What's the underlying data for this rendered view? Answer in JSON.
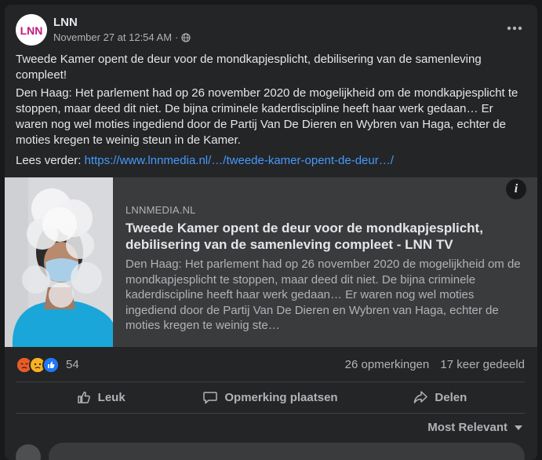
{
  "post": {
    "page_name": "LNN",
    "timestamp": "November 27 at 12:54 AM",
    "separator": "·",
    "privacy_icon": "globe-icon",
    "avatar_text": "LNN",
    "more_icon": "more-icon",
    "text_title": "Tweede Kamer opent de deur voor de mondkapjesplicht, debilisering van de samenleving compleet!",
    "text_body": "Den Haag: Het parlement had op 26 november 2020 de mogelijkheid om de mondkapjesplicht te stoppen, maar deed dit niet. De bijna criminele kaderdiscipline heeft haar werk gedaan… Er waren nog wel moties ingediend door de Partij Van De Dieren en Wybren van Haga, echter de moties kregen te weinig steun in de Kamer.",
    "read_more_label": "Lees verder:",
    "read_more_url": "https://www.lnnmedia.nl/…/tweede-kamer-opent-de-deur…/"
  },
  "preview": {
    "domain": "LNNMEDIA.NL",
    "title": "Tweede Kamer opent de deur voor de mondkapjesplicht, debilisering van de samenleving compleet - LNN TV",
    "description": "Den Haag: Het parlement had op 26 november 2020 de mogelijkheid om de mondkapjesplicht te stoppen, maar deed dit niet. De bijna criminele kaderdiscipline heeft haar werk gedaan… Er waren nog wel moties ingediend door de Partij Van De Dieren en Wybren van Haga, echter de moties kregen te weinig ste…",
    "info_label": "i"
  },
  "engagement": {
    "reaction_count": "54",
    "comments": "26 opmerkingen",
    "shares": "17 keer gedeeld",
    "reactions": [
      "angry",
      "sad",
      "like"
    ]
  },
  "actions": {
    "like": "Leuk",
    "comment": "Opmerking plaatsen",
    "share": "Delen"
  },
  "comments": {
    "sort_label": "Most Relevant"
  },
  "colors": {
    "background": "#18191a",
    "card": "#242526",
    "link": "#4599ff",
    "text": "#e4e6eb",
    "secondary": "#b0b3b8"
  }
}
